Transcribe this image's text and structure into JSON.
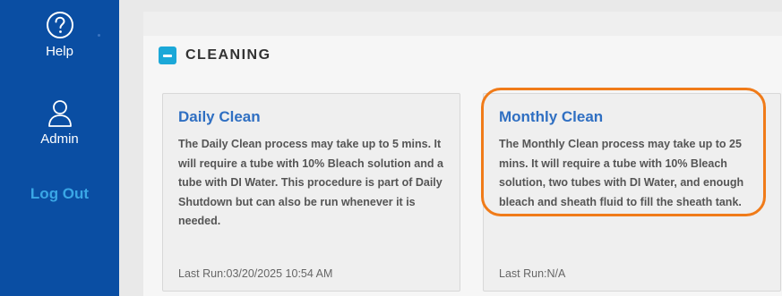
{
  "sidebar": {
    "items": [
      {
        "label": "Help",
        "icon": "help-circle-icon"
      },
      {
        "label": "Admin",
        "icon": "user-icon"
      }
    ],
    "logout_label": "Log Out"
  },
  "section": {
    "title": "CLEANING",
    "toggle_icon": "collapse-minus-icon"
  },
  "cards": [
    {
      "title": "Daily Clean",
      "description": "The Daily Clean process may take up to 5 mins. It will require a tube with 10% Bleach solution and a tube with DI Water. This procedure is part of Daily Shutdown but can also be run whenever it is needed.",
      "last_run": "Last Run:03/20/2025 10:54 AM"
    },
    {
      "title": "Monthly Clean",
      "description": "The Monthly Clean process may take up to 25 mins. It will require a tube with 10% Bleach solution, two tubes with DI Water, and enough bleach and sheath fluid to fill the sheath tank.",
      "last_run": "Last Run:N/A",
      "highlighted": true
    }
  ],
  "colors": {
    "sidebar": "#0a4ea3",
    "logout": "#3aa7e6",
    "card_title": "#2f6fc2",
    "toggle": "#1ba8d8",
    "highlight": "#f07b19"
  }
}
